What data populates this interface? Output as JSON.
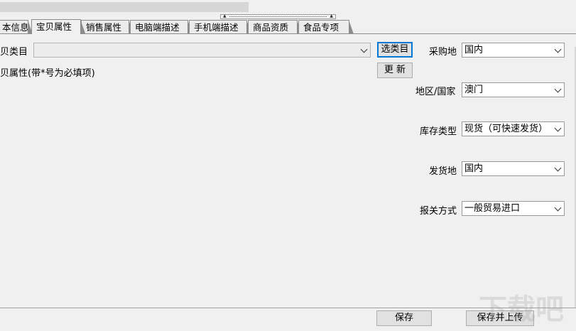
{
  "tabs": [
    {
      "label": "本信息",
      "active": false
    },
    {
      "label": "宝贝属性",
      "active": true
    },
    {
      "label": "销售属性",
      "active": false
    },
    {
      "label": "电脑端描述",
      "active": false
    },
    {
      "label": "手机端描述",
      "active": false
    },
    {
      "label": "商品资质",
      "active": false
    },
    {
      "label": "食品专项",
      "active": false
    }
  ],
  "category": {
    "label": "贝类目",
    "value": "",
    "select_button": "选类目",
    "update_button": "更 新"
  },
  "attributes_label": "贝属性(带*号为必填项)",
  "right_form": {
    "purchase_place": {
      "label": "采购地",
      "value": "国内"
    },
    "region": {
      "label": "地区/国家",
      "value": "澳门"
    },
    "stock_type": {
      "label": "库存类型",
      "value": "现货（可快速发货）"
    },
    "ship_from": {
      "label": "发货地",
      "value": "国内"
    },
    "customs": {
      "label": "报关方式",
      "value": "一般贸易进口"
    }
  },
  "footer": {
    "save": "保存",
    "save_upload": "保存并上传"
  },
  "watermark_text": "下载吧"
}
